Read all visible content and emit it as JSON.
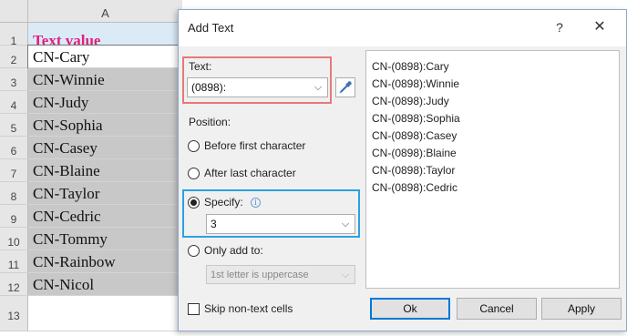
{
  "sheet": {
    "column_header": "A",
    "rows": [
      {
        "num": "1",
        "value": "Text value"
      },
      {
        "num": "2",
        "value": "CN-Cary"
      },
      {
        "num": "3",
        "value": "CN-Winnie"
      },
      {
        "num": "4",
        "value": "CN-Judy"
      },
      {
        "num": "5",
        "value": "CN-Sophia"
      },
      {
        "num": "6",
        "value": "CN-Casey"
      },
      {
        "num": "7",
        "value": "CN-Blaine"
      },
      {
        "num": "8",
        "value": "CN-Taylor"
      },
      {
        "num": "9",
        "value": "CN-Cedric"
      },
      {
        "num": "10",
        "value": "CN-Tommy"
      },
      {
        "num": "11",
        "value": "CN-Rainbow"
      },
      {
        "num": "12",
        "value": "CN-Nicol"
      },
      {
        "num": "13",
        "value": ""
      }
    ],
    "header_color": "#e0217a",
    "header_bg": "#dbeaf7",
    "selection_bg": "#c8c8c8"
  },
  "dialog": {
    "title": "Add Text",
    "help_glyph": "?",
    "close_glyph": "✕",
    "text_label": "Text:",
    "text_value": "(0898):",
    "picker_icon": "eyedropper-icon",
    "position_label": "Position:",
    "options": {
      "before_first": "Before first character",
      "after_last": "After last character",
      "specify": "Specify:",
      "only_add_to": "Only add to:"
    },
    "selected_option": "specify",
    "specify_value": "3",
    "only_add_value": "1st letter is uppercase",
    "skip_label": "Skip non-text cells",
    "skip_checked": false,
    "preview": [
      "CN-(0898):Cary",
      "CN-(0898):Winnie",
      "CN-(0898):Judy",
      "CN-(0898):Sophia",
      "CN-(0898):Casey",
      "CN-(0898):Blaine",
      "CN-(0898):Taylor",
      "CN-(0898):Cedric"
    ],
    "buttons": {
      "ok": "Ok",
      "cancel": "Cancel",
      "apply": "Apply"
    },
    "highlight_text_color": "#e8787a",
    "highlight_specify_color": "#2ba1e0"
  }
}
